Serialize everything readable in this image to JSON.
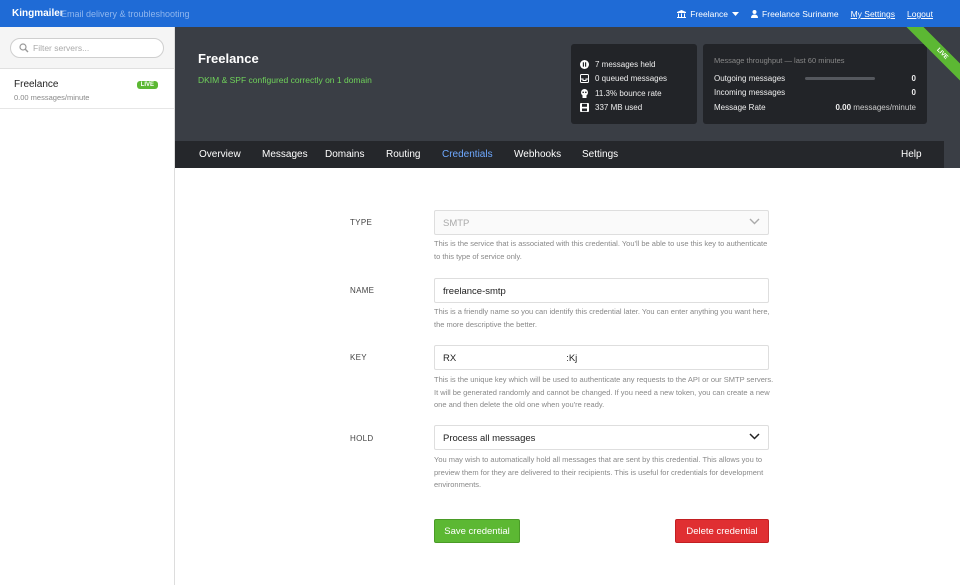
{
  "topbar": {
    "brand": "Kingmailer",
    "tagline": "Email delivery & troubleshooting",
    "org_label": "Freelance",
    "user_name": "Freelance Suriname",
    "my_settings": "My Settings",
    "logout": "Logout"
  },
  "sidebar": {
    "search_placeholder": "Filter servers...",
    "servers": [
      {
        "name": "Freelance",
        "rate": "0.00 messages/minute",
        "badge": "LIVE"
      }
    ]
  },
  "server": {
    "title": "Freelance",
    "subtitle": "DKIM & SPF configured correctly on 1 domain",
    "ribbon": "LIVE",
    "stats": [
      {
        "icon": "pause-icon",
        "text": "7 messages held"
      },
      {
        "icon": "inbox-icon",
        "text": "0 queued messages"
      },
      {
        "icon": "bounce-icon",
        "text": "11.3% bounce rate"
      },
      {
        "icon": "disk-icon",
        "text": "337 MB used"
      }
    ],
    "throughput": {
      "title": "Message throughput — last 60 minutes",
      "outgoing_label": "Outgoing messages",
      "outgoing_value": "0",
      "outgoing_fill": 0,
      "incoming_label": "Incoming messages",
      "incoming_value": "0",
      "rate_label": "Message Rate",
      "rate_value": "0.00",
      "rate_unit": "messages/minute"
    }
  },
  "nav": {
    "items": [
      "Overview",
      "Messages",
      "Domains",
      "Routing",
      "Credentials",
      "Webhooks",
      "Settings"
    ],
    "active": "Credentials",
    "help": "Help"
  },
  "form": {
    "type": {
      "label": "TYPE",
      "value": "SMTP",
      "hint": "This is the service that is associated with this credential. You'll be able to use this key to authenticate to this type of service only."
    },
    "name": {
      "label": "NAME",
      "value": "freelance-smtp",
      "hint": "This is a friendly name so you can identify this credential later. You can enter anything you want here, the more descriptive the better."
    },
    "key": {
      "label": "KEY",
      "value_start": "RX",
      "value_end": ":Kj",
      "hint": "This is the unique key which will be used to authenticate any requests to the API or our SMTP servers. It will be generated randomly and cannot be changed. If you need a new token, you can create a new one and then delete the old one when you're ready."
    },
    "hold": {
      "label": "HOLD",
      "value": "Process all messages",
      "hint": "You may wish to automatically hold all messages that are sent by this credential. This allows you to preview them for they are delivered to their recipients. This is useful for credentials for development environments."
    },
    "save_label": "Save credential",
    "delete_label": "Delete credential"
  },
  "colors": {
    "brand_blue": "#1f6bd6",
    "header_dark": "#3a3e45",
    "nav_dark": "#25272b",
    "live_green": "#5cb833",
    "danger_red": "#e02f32",
    "active_nav": "#6ea8ff"
  }
}
